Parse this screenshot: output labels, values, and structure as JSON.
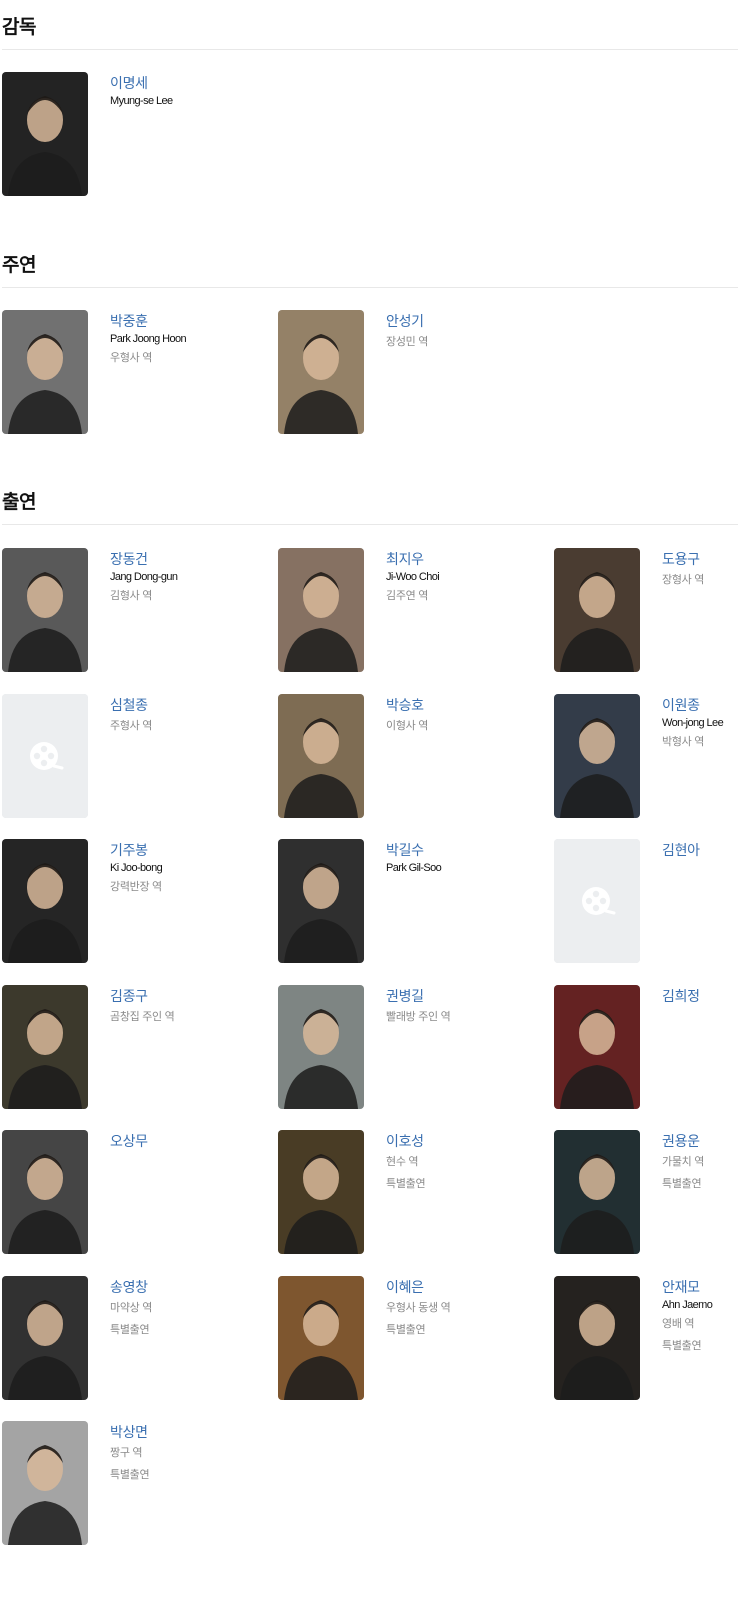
{
  "sections": {
    "director": {
      "title": "감독",
      "people": [
        {
          "name": "이명세",
          "eng": "Myung-se Lee",
          "role": "",
          "note": "",
          "has_photo": true,
          "tone": "#2b2b2b"
        }
      ]
    },
    "lead": {
      "title": "주연",
      "people": [
        {
          "name": "박중훈",
          "eng": "Park Joong Hoon",
          "role": "우형사 역",
          "note": "",
          "has_photo": true,
          "tone": "#8a8a8a"
        },
        {
          "name": "안성기",
          "eng": "",
          "role": "장성민 역",
          "note": "",
          "has_photo": true,
          "tone": "#b59e7e"
        }
      ]
    },
    "cast": {
      "title": "출연",
      "people": [
        {
          "name": "장동건",
          "eng": "Jang Dong-gun",
          "role": "김형사 역",
          "note": "",
          "has_photo": true,
          "tone": "#6d6d6d"
        },
        {
          "name": "최지우",
          "eng": "Ji-Woo Choi",
          "role": "김주연 역",
          "note": "",
          "has_photo": true,
          "tone": "#a48a78"
        },
        {
          "name": "도용구",
          "eng": "",
          "role": "장형사 역",
          "note": "",
          "has_photo": true,
          "tone": "#5b4a3c"
        },
        {
          "name": "심철종",
          "eng": "",
          "role": "주형사 역",
          "note": "",
          "has_photo": false,
          "tone": "#eceef0"
        },
        {
          "name": "박승호",
          "eng": "",
          "role": "이형사 역",
          "note": "",
          "has_photo": true,
          "tone": "#9a8466"
        },
        {
          "name": "이원종",
          "eng": "Won-jong Lee",
          "role": "박형사 역",
          "note": "",
          "has_photo": true,
          "tone": "#3f4a5a"
        },
        {
          "name": "기주봉",
          "eng": "Ki Joo-bong",
          "role": "강력반장 역",
          "note": "",
          "has_photo": true,
          "tone": "#2e2e2e"
        },
        {
          "name": "박길수",
          "eng": "Park Gil-Soo",
          "role": "",
          "note": "",
          "has_photo": true,
          "tone": "#3a3a3a"
        },
        {
          "name": "김현아",
          "eng": "",
          "role": "",
          "note": "",
          "has_photo": false,
          "tone": "#eceef0"
        },
        {
          "name": "김종구",
          "eng": "",
          "role": "곰창집 주인 역",
          "note": "",
          "has_photo": true,
          "tone": "#4a4636"
        },
        {
          "name": "권병길",
          "eng": "",
          "role": "빨래방 주인 역",
          "note": "",
          "has_photo": true,
          "tone": "#9aa3a0"
        },
        {
          "name": "김희정",
          "eng": "",
          "role": "",
          "note": "",
          "has_photo": true,
          "tone": "#7a2a2a"
        },
        {
          "name": "오상무",
          "eng": "",
          "role": "",
          "note": "",
          "has_photo": true,
          "tone": "#555"
        },
        {
          "name": "이호성",
          "eng": "",
          "role": "현수 역",
          "note": "특별출연",
          "has_photo": true,
          "tone": "#5a4a2e"
        },
        {
          "name": "권용운",
          "eng": "",
          "role": "가물치 역",
          "note": "특별출연",
          "has_photo": true,
          "tone": "#2a3a3e"
        },
        {
          "name": "송영창",
          "eng": "",
          "role": "마약상 역",
          "note": "특별출연",
          "has_photo": true,
          "tone": "#3c3c3c"
        },
        {
          "name": "이혜은",
          "eng": "",
          "role": "우형사 동생 역",
          "note": "특별출연",
          "has_photo": true,
          "tone": "#9a6a3a"
        },
        {
          "name": "안재모",
          "eng": "Ahn Jaemo",
          "role": "영배 역",
          "note": "특별출연",
          "has_photo": true,
          "tone": "#2e2a26"
        },
        {
          "name": "박상면",
          "eng": "",
          "role": "짱구 역",
          "note": "특별출연",
          "has_photo": true,
          "tone": "#c8c8c8"
        }
      ]
    }
  }
}
